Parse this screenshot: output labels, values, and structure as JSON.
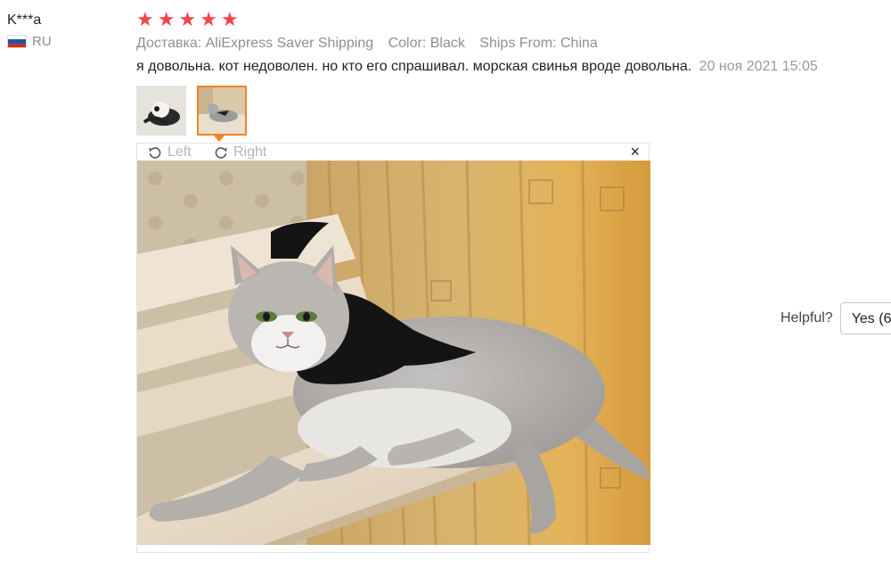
{
  "user": {
    "name": "K***a",
    "country": "RU",
    "flag_colors": [
      "#ffffff",
      "#1c57a5",
      "#d52b1e"
    ]
  },
  "review": {
    "rating": 5,
    "stars": [
      "★",
      "★",
      "★",
      "★",
      "★"
    ],
    "star_color": "#f0464b",
    "meta": {
      "delivery": "Доставка: AliExpress Saver Shipping",
      "color": "Color: Black",
      "ships_from": "Ships From: China"
    },
    "text": "я довольна. кот недоволен. но кто его спрашивал. морская свинья вроде довольна.",
    "date": "20 ноя 2021 15:05"
  },
  "thumbnails": [
    {
      "name": "thumbnail-1",
      "active": false
    },
    {
      "name": "thumbnail-2",
      "active": true
    }
  ],
  "accent_color": "#f58220",
  "viewer": {
    "rotate_left_label": "Left",
    "rotate_right_label": "Right",
    "close_icon": "×"
  },
  "helpful": {
    "label": "Helpful?",
    "yes_button": "Yes (6"
  }
}
